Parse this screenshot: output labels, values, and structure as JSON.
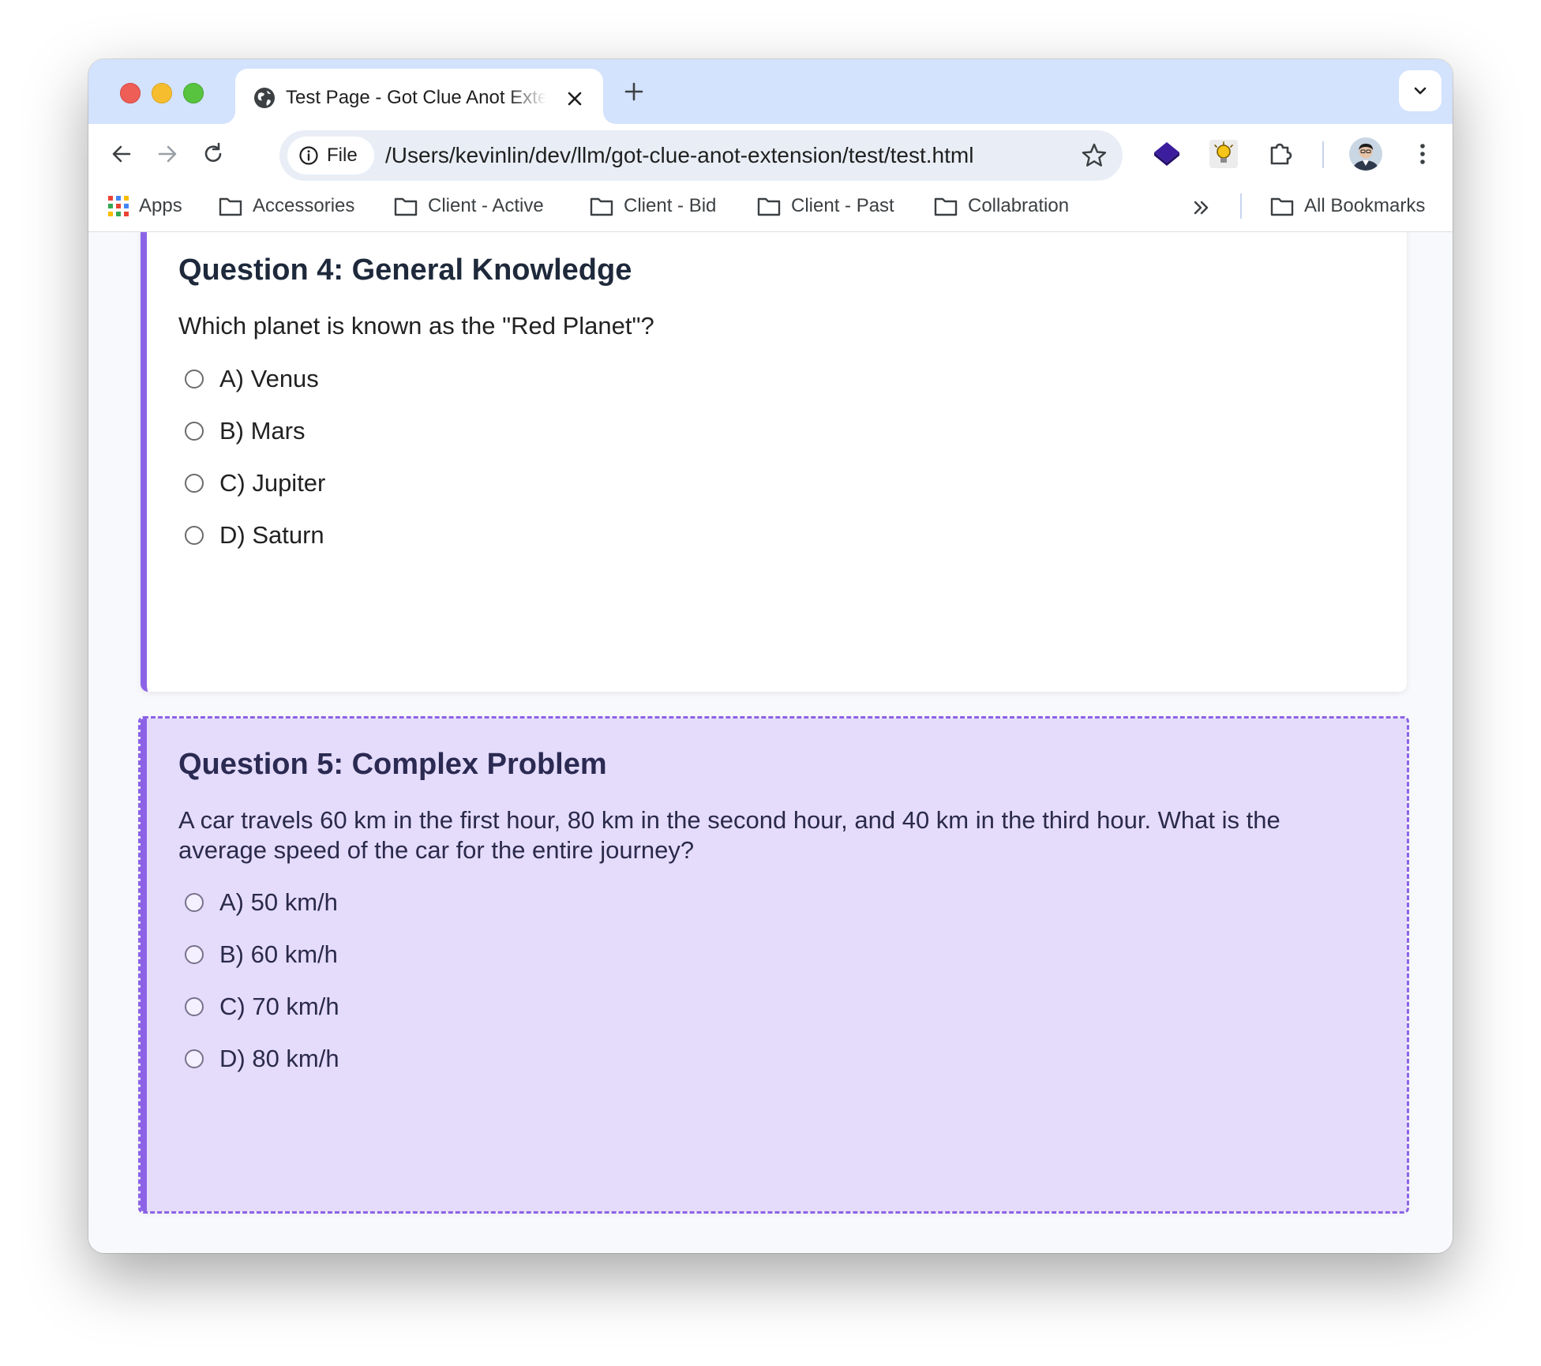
{
  "browser": {
    "tab": {
      "title": "Test Page - Got Clue Anot Extension Test"
    },
    "address_bar": {
      "scheme_label": "File",
      "url": "/Users/kevinlin/dev/llm/got-clue-anot-extension/test/test.html"
    },
    "bookmarks": [
      {
        "label": "Apps",
        "icon": "apps-grid-icon"
      },
      {
        "label": "Accessories",
        "icon": "folder-icon"
      },
      {
        "label": "Client - Active",
        "icon": "folder-icon"
      },
      {
        "label": "Client - Bid",
        "icon": "folder-icon"
      },
      {
        "label": "Client - Past",
        "icon": "folder-icon"
      },
      {
        "label": "Collabration",
        "icon": "folder-icon"
      }
    ],
    "all_bookmarks_label": "All Bookmarks"
  },
  "questions": [
    {
      "title": "Question 4: General Knowledge",
      "text": "Which planet is known as the \"Red Planet\"?",
      "options": [
        "A) Venus",
        "B) Mars",
        "C) Jupiter",
        "D) Saturn"
      ]
    },
    {
      "title": "Question 5: Complex Problem",
      "text": "A car travels 60 km in the first hour, 80 km in the second hour, and 40 km in the third hour. What is the average speed of the car for the entire journey?",
      "options": [
        "A) 50 km/h",
        "B) 60 km/h",
        "C) 70 km/h",
        "D) 80 km/h"
      ]
    }
  ],
  "colors": {
    "accent": "#8c63e6",
    "highlight_background": "#e5dcfc",
    "tab_strip": "#d3e2fd"
  }
}
